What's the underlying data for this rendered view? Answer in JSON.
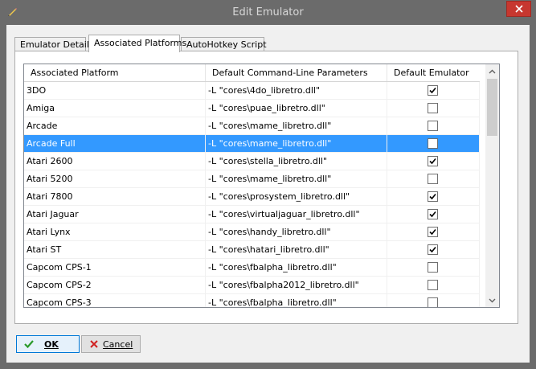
{
  "window": {
    "title": "Edit Emulator"
  },
  "tabs": [
    {
      "label": "Emulator Details",
      "active": false
    },
    {
      "label": "Associated Platforms",
      "active": true
    },
    {
      "label": "AutoHotkey Script",
      "active": false
    }
  ],
  "grid": {
    "columns": [
      "Associated Platform",
      "Default Command-Line Parameters",
      "Default Emulator"
    ],
    "rows": [
      {
        "platform": "3DO",
        "params": "-L \"cores\\4do_libretro.dll\"",
        "default": true
      },
      {
        "platform": "Amiga",
        "params": "-L \"cores\\puae_libretro.dll\"",
        "default": false
      },
      {
        "platform": "Arcade",
        "params": "-L \"cores\\mame_libretro.dll\"",
        "default": false
      },
      {
        "platform": "Arcade Full",
        "params": "-L \"cores\\mame_libretro.dll\"",
        "default": false,
        "selected": true
      },
      {
        "platform": "Atari 2600",
        "params": "-L \"cores\\stella_libretro.dll\"",
        "default": true
      },
      {
        "platform": "Atari 5200",
        "params": "-L \"cores\\mame_libretro.dll\"",
        "default": false
      },
      {
        "platform": "Atari 7800",
        "params": "-L \"cores\\prosystem_libretro.dll\"",
        "default": true
      },
      {
        "platform": "Atari Jaguar",
        "params": "-L \"cores\\virtualjaguar_libretro.dll\"",
        "default": true
      },
      {
        "platform": "Atari Lynx",
        "params": "-L \"cores\\handy_libretro.dll\"",
        "default": true
      },
      {
        "platform": "Atari ST",
        "params": "-L \"cores\\hatari_libretro.dll\"",
        "default": true
      },
      {
        "platform": "Capcom CPS-1",
        "params": "-L \"cores\\fbalpha_libretro.dll\"",
        "default": false
      },
      {
        "platform": "Capcom CPS-2",
        "params": "-L \"cores\\fbalpha2012_libretro.dll\"",
        "default": false
      },
      {
        "platform": "Capcom CPS-3",
        "params": "-L \"cores\\fbalpha_libretro.dll\"",
        "default": false
      }
    ]
  },
  "buttons": {
    "ok": {
      "label": "OK",
      "icon": "check-icon",
      "color": "#2a9a2a"
    },
    "cancel": {
      "label": "Cancel",
      "icon": "x-icon",
      "color": "#d02020"
    }
  },
  "colors": {
    "selection": "#3399ff",
    "close": "#c7372f"
  }
}
